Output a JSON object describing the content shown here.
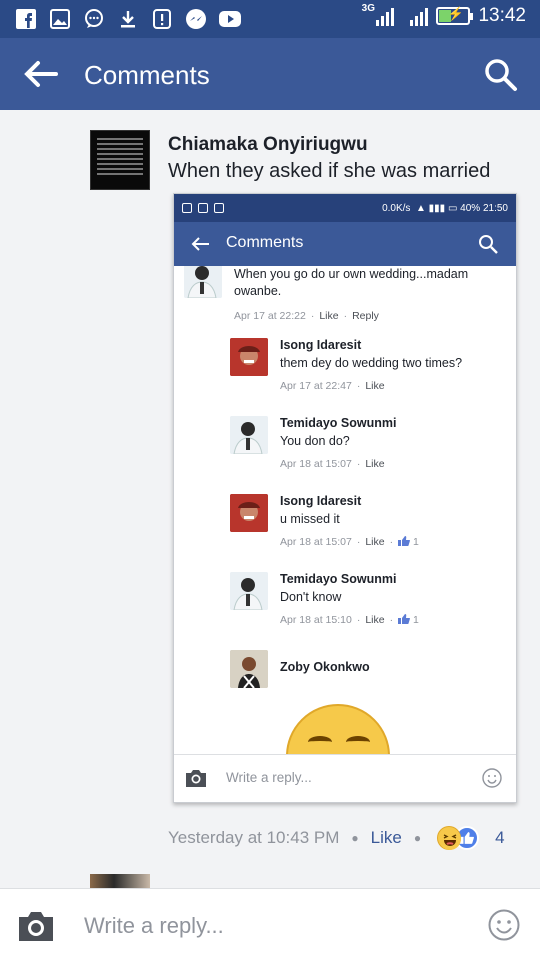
{
  "status_bar": {
    "time": "13:42",
    "network": "3G",
    "icons": [
      "facebook-icon",
      "gallery-icon",
      "chat-icon",
      "download-icon",
      "alert-icon",
      "messenger-icon",
      "youtube-icon"
    ]
  },
  "app_bar": {
    "title": "Comments",
    "back_icon": "back-arrow-icon",
    "search_icon": "search-icon",
    "color": "#3b5998"
  },
  "comment": {
    "author": "Chiamaka Onyiriugwu",
    "text": "When they asked if she was married",
    "timestamp": "Yesterday at 10:43 PM",
    "like_label": "Like",
    "reactions": [
      "haha",
      "like"
    ],
    "reaction_count": "4"
  },
  "screenshot": {
    "status": {
      "speed": "0.0K/s",
      "battery": "40%",
      "time": "21:50"
    },
    "app_bar_title": "Comments",
    "comments": [
      {
        "name": "",
        "text_lines": [
          "When you go do ur own wedding...madam",
          "owanbe."
        ],
        "time": "Apr 17 at 22:22",
        "like": "Like",
        "reply": "Reply"
      },
      {
        "name": "Isong Idaresit",
        "text": "them dey do wedding two times?",
        "time": "Apr 17 at 22:47",
        "like": "Like"
      },
      {
        "name": "Temidayo Sowunmi",
        "text": "You don do?",
        "time": "Apr 18 at 15:07",
        "like": "Like"
      },
      {
        "name": "Isong Idaresit",
        "text": "u missed it",
        "time": "Apr 18 at 15:07",
        "like": "Like",
        "count": "1"
      },
      {
        "name": "Temidayo Sowunmi",
        "text": "Don't know",
        "time": "Apr 18 at 15:10",
        "like": "Like",
        "count": "1"
      },
      {
        "name": "Zoby Okonkwo"
      }
    ],
    "reply_placeholder": "Write a reply..."
  },
  "reply_bar": {
    "placeholder": "Write a reply...",
    "camera_icon": "camera-icon",
    "emoji_icon": "smiley-icon"
  }
}
